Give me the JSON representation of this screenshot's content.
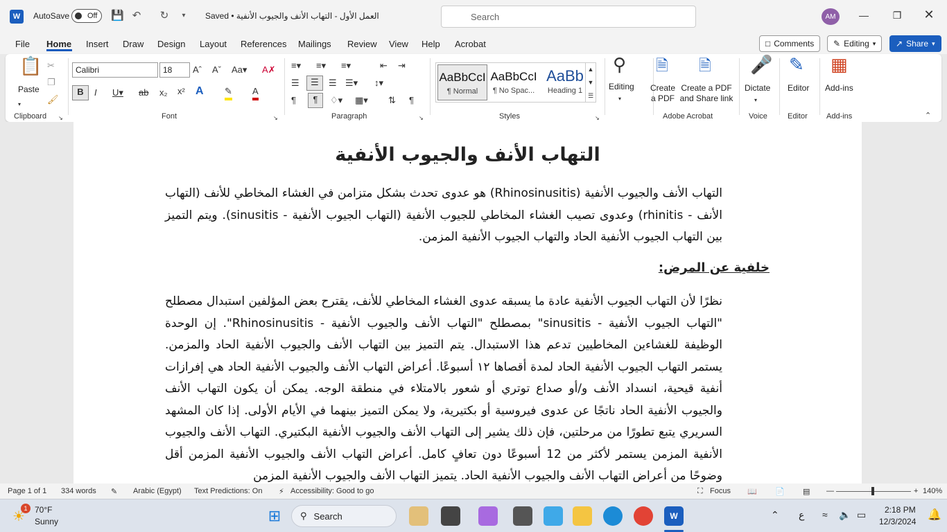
{
  "titlebar": {
    "autosave_label": "AutoSave",
    "autosave_state": "Off",
    "doc_title": "العمل الأول - التهاب الأنف والجيوب الأنفية • Saved",
    "search_placeholder": "Search",
    "avatar_initials": "AM"
  },
  "menu": {
    "items": [
      "File",
      "Home",
      "Insert",
      "Draw",
      "Design",
      "Layout",
      "References",
      "Mailings",
      "Review",
      "View",
      "Help",
      "Acrobat"
    ],
    "comments": "Comments",
    "editing": "Editing",
    "share": "Share"
  },
  "ribbon": {
    "paste": "Paste",
    "clipboard": "Clipboard",
    "font_name": "Calibri",
    "font_size": "18",
    "font": "Font",
    "paragraph": "Paragraph",
    "styles": "Styles",
    "style_items": [
      {
        "preview": "AaBbCcI",
        "name": "¶ Normal"
      },
      {
        "preview": "AaBbCcI",
        "name": "¶ No Spac..."
      },
      {
        "preview": "AaBb",
        "name": "Heading 1"
      }
    ],
    "editing_btn": "Editing",
    "create_pdf": "Create a PDF",
    "create_share": "Create a PDF and Share link",
    "adobe_acrobat": "Adobe Acrobat",
    "dictate": "Dictate",
    "voice": "Voice",
    "editor_btn": "Editor",
    "editor_grp": "Editor",
    "addins_btn": "Add-ins",
    "addins_grp": "Add-ins"
  },
  "document": {
    "title": "التهاب الأنف والجيوب الأنفية",
    "intro": "التهاب الأنف والجيوب الأنفية (Rhinosinusitis) هو عدوى تحدث بشكل متزامن في الغشاء المخاطي للأنف (التهاب الأنف - rhinitis) وعدوى تصيب الغشاء المخاطي للجيوب الأنفية (التهاب الجيوب الأنفية - sinusitis). ويتم التميز بين التهاب الجيوب الأنفية الحاد والتهاب الجيوب الأنفية المزمن.",
    "subheading": "خلفية عن المرض:",
    "body": "نظرًا لأن التهاب الجيوب الأنفية عادة ما يسبقه عدوى الغشاء المخاطي للأنف، يقترح بعض المؤلفين استبدال مصطلح \"التهاب الجيوب الأنفية - sinusitis\" بمصطلح \"التهاب الأنف والجيوب الأنفية - Rhinosinusitis\". إن الوحدة الوظيفة للغشاءين المخاطيين تدعم هذا الاستبدال. يتم التميز بين التهاب الأنف والجيوب الأنفية الحاد والمزمن. يستمر التهاب الجيوب الأنفية الحاد لمدة أقصاها ١٢ أسبوعًا. أعراض التهاب الأنف والجيوب الأنفية الحاد هي إفرازات أنفية قيحية، انسداد الأنف و/أو صداع توتري أو شعور بالامتلاء في منطقة الوجه. يمكن أن يكون التهاب الأنف والجيوب الأنفية الحاد ناتجًا عن عدوى فيروسية أو بكتيرية، ولا يمكن التميز بينهما في الأيام الأولى. إذا كان المشهد السريري يتبع تطورًا من مرحلتين، فإن ذلك يشير إلى التهاب الأنف والجيوب الأنفية البكتيري. التهاب الأنف والجيوب الأنفية المزمن يستمر لأكثر من 12 أسبوعًا دون تعافٍ كامل. أعراض التهاب الأنف والجيوب الأنفية المزمن أقل وضوحًا من أعراض التهاب الأنف والجيوب الأنفية الحاد. يتميز التهاب الأنف والجيوب الأنفية المزمن"
  },
  "status": {
    "page": "Page 1 of 1",
    "words": "334 words",
    "language": "Arabic (Egypt)",
    "predictions": "Text Predictions: On",
    "accessibility": "Accessibility: Good to go",
    "focus": "Focus",
    "zoom": "140%"
  },
  "taskbar": {
    "temp": "70°F",
    "condition": "Sunny",
    "badge": "1",
    "search": "Search",
    "time": "2:18 PM",
    "date": "12/3/2024",
    "lang_ind": "ع"
  },
  "colors": {
    "accent": "#185abd",
    "word_blue": "#1b5ebe"
  }
}
